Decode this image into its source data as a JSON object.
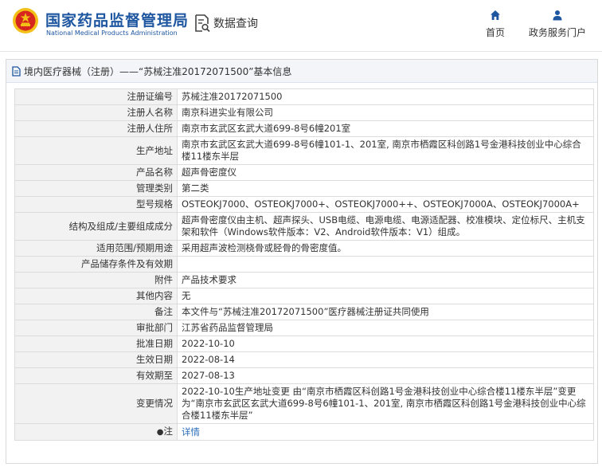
{
  "site": {
    "name_cn": "国家药品监督管理局",
    "name_en": "National Medical Products Administration",
    "emblem_icon": "national-emblem-icon",
    "colors": {
      "brand_blue": "#1e56a0",
      "emblem_red": "#d7261e",
      "emblem_gold": "#f3c018"
    }
  },
  "header": {
    "data_query_label": "数据查询",
    "data_query_icon": "search-document-icon",
    "nav": [
      {
        "label": "首页",
        "icon": "home-icon"
      },
      {
        "label": "政务服务门户",
        "icon": "user-icon"
      }
    ]
  },
  "panel": {
    "title": "境内医疗器械（注册）——“苏械注准20172071500”基本信息",
    "title_icon": "document-icon"
  },
  "rows": [
    {
      "label": "注册证编号",
      "value": "苏械注准20172071500"
    },
    {
      "label": "注册人名称",
      "value": "南京科进实业有限公司"
    },
    {
      "label": "注册人住所",
      "value": "南京市玄武区玄武大道699-8号6幢201室"
    },
    {
      "label": "生产地址",
      "value": "南京市玄武区玄武大道699-8号6幢101-1、201室, 南京市栖霞区科创路1号金港科技创业中心综合楼11楼东半层"
    },
    {
      "label": "产品名称",
      "value": "超声骨密度仪"
    },
    {
      "label": "管理类别",
      "value": "第二类"
    },
    {
      "label": "型号规格",
      "value": "OSTEOKJ7000、OSTEOKJ7000+、OSTEOKJ7000++、OSTEOKJ7000A、OSTEOKJ7000A+"
    },
    {
      "label": "结构及组成/主要组成成分",
      "value": "超声骨密度仪由主机、超声探头、USB电缆、电源电缆、电源适配器、校准模块、定位标尺、主机支架和软件（Windows软件版本：V2、Android软件版本：V1）组成。"
    },
    {
      "label": "适用范围/预期用途",
      "value": "采用超声波检测桡骨或胫骨的骨密度值。"
    },
    {
      "label": "产品储存条件及有效期",
      "value": ""
    },
    {
      "label": "附件",
      "value": "产品技术要求"
    },
    {
      "label": "其他内容",
      "value": "无"
    },
    {
      "label": "备注",
      "value": "本文件与“苏械注准20172071500”医疗器械注册证共同使用"
    },
    {
      "label": "审批部门",
      "value": "江苏省药品监督管理局"
    },
    {
      "label": "批准日期",
      "value": "2022-10-10"
    },
    {
      "label": "生效日期",
      "value": "2022-08-14"
    },
    {
      "label": "有效期至",
      "value": "2027-08-13"
    },
    {
      "label": "变更情况",
      "value": "2022-10-10生产地址变更 由“南京市栖霞区科创路1号金港科技创业中心综合楼11楼东半层”变更为“南京市玄武区玄武大道699-8号6幢101-1、201室, 南京市栖霞区科创路1号金港科技创业中心综合楼11楼东半层”"
    }
  ],
  "note_row": {
    "pin_icon": "pin-icon",
    "label": "注",
    "link": "详情",
    "link_color": "#2a6ebb"
  }
}
